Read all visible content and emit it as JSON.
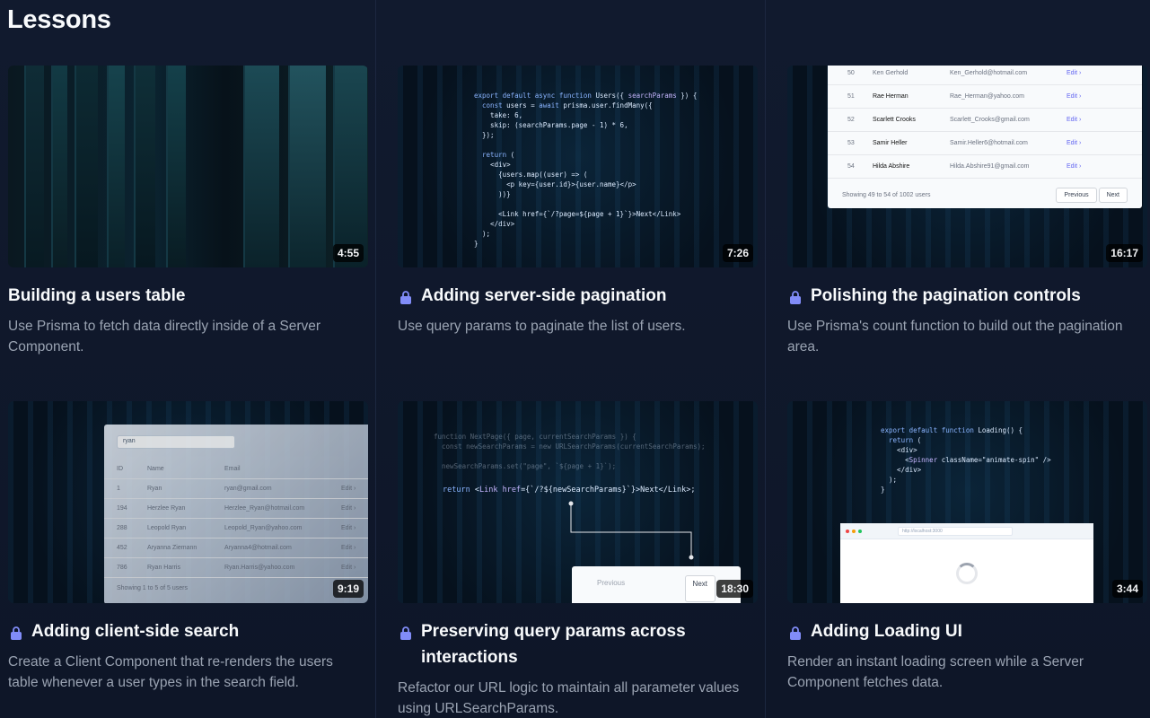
{
  "page": {
    "title": "Lessons"
  },
  "lessons": [
    {
      "title": "Building a users table",
      "description": "Use Prisma to fetch data directly inside of a Server Component.",
      "duration": "4:55",
      "locked": false
    },
    {
      "title": "Adding server-side pagination",
      "description": "Use query params to paginate the list of users.",
      "duration": "7:26",
      "locked": true
    },
    {
      "title": "Polishing the pagination controls",
      "description": "Use Prisma's count function to build out the pagination area.",
      "duration": "16:17",
      "locked": true
    },
    {
      "title": "Adding client-side search",
      "description": "Create a Client Component that re-renders the users table whenever a user types in the search field.",
      "duration": "9:19",
      "locked": true
    },
    {
      "title": "Preserving query params across interactions",
      "description": "Refactor our URL logic to maintain all parameter values using URLSearchParams.",
      "duration": "18:30",
      "locked": true
    },
    {
      "title": "Adding Loading UI",
      "description": "Render an instant loading screen while a Server Component fetches data.",
      "duration": "3:44",
      "locked": true
    }
  ],
  "thumb3": {
    "rows": [
      {
        "id": "50",
        "name": "Ken Gerhold",
        "email": "Ken_Gerhold@hotmail.com",
        "action": "Edit ›"
      },
      {
        "id": "51",
        "name": "Rae Herman",
        "email": "Rae_Herman@yahoo.com",
        "action": "Edit ›"
      },
      {
        "id": "52",
        "name": "Scarlett Crooks",
        "email": "Scarlett_Crooks@gmail.com",
        "action": "Edit ›"
      },
      {
        "id": "53",
        "name": "Samir Heller",
        "email": "Samir.Heller6@hotmail.com",
        "action": "Edit ›"
      },
      {
        "id": "54",
        "name": "Hilda Abshire",
        "email": "Hilda.Abshire91@gmail.com",
        "action": "Edit ›"
      }
    ],
    "footer": "Showing 49 to 54 of 1002 users",
    "previous": "Previous",
    "next": "Next"
  },
  "thumb4": {
    "search_value": "ryan",
    "headers": [
      "ID",
      "Name",
      "Email"
    ],
    "rows": [
      {
        "id": "1",
        "name": "Ryan",
        "email": "ryan@gmail.com",
        "action": "Edit ›"
      },
      {
        "id": "194",
        "name": "Herzlee Ryan",
        "email": "Herzlee_Ryan@hotmail.com",
        "action": "Edit ›"
      },
      {
        "id": "288",
        "name": "Leopold Ryan",
        "email": "Leopold_Ryan@yahoo.com",
        "action": "Edit ›"
      },
      {
        "id": "452",
        "name": "Aryanna Ziemann",
        "email": "Aryanna4@hotmail.com",
        "action": "Edit ›"
      },
      {
        "id": "786",
        "name": "Ryan Harris",
        "email": "Ryan.Harris@yahoo.com",
        "action": "Edit ›"
      }
    ],
    "footer": "Showing 1 to 5 of 5 users"
  },
  "thumb5": {
    "previous": "Previous",
    "next": "Next"
  },
  "thumb6": {
    "url": "http://localhost:3000"
  }
}
